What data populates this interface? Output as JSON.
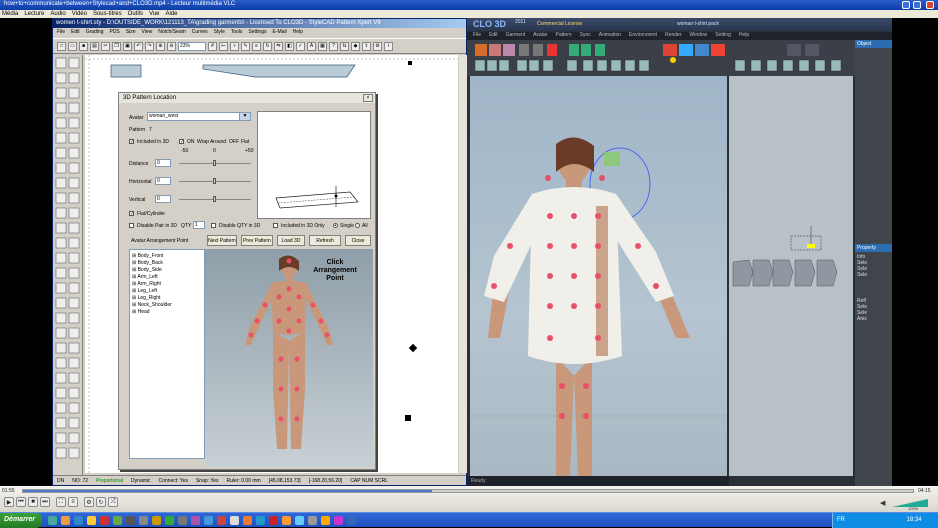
{
  "vlc": {
    "title": "how+to+communicate+between+Stylecad+and+CLO3D.mp4 - Lecteur multimédia VLC",
    "menu": [
      "Média",
      "Lecture",
      "Audio",
      "Vidéo",
      "Sous-titres",
      "Outils",
      "Vue",
      "Aide"
    ],
    "time_elapsed": "01:55",
    "time_total": "04:15",
    "progress": 0.46,
    "volume": "100%"
  },
  "stylecad": {
    "title": "women t-shirt.sty - D:\\OUTSIDE_WORK\\121113_TA\\grading garments\\ - Licensed To CLO3D - StyleCAD Pattern Xpert V9",
    "menu": [
      "File",
      "Edit",
      "Grading",
      "PDS",
      "Size",
      "View",
      "Notch/Seam",
      "Curves",
      "Style",
      "Tools",
      "Settings",
      "E-Mail",
      "Help"
    ],
    "zoom": "23%",
    "status": [
      "DN",
      "NO: 72",
      "Proportional",
      "Dynamic",
      "Connect: Yes",
      "Snap: Yes",
      "Ruler: 0.00 mm",
      "[45.08,153.73]",
      "[-168.20,56.20]",
      "CAP NUM SCRL"
    ]
  },
  "dialog": {
    "title": "3D Pattern Location",
    "avatar_label": "Avatar",
    "avatar_value": "woman_west",
    "pattern_label": "Pattern",
    "pattern_value": "7",
    "included_label": "Included in 3D",
    "wrap_label": "ON",
    "wrap_around": "Wrap Around",
    "off_label": "OFF",
    "flat_label": "Flat",
    "scale_min": "-50",
    "scale_mid": "0",
    "scale_max": "+50",
    "distance_label": "Distance",
    "distance_value": "0",
    "horizontal_label": "Horizontal",
    "horizontal_value": "0",
    "vertical_label": "Vertical",
    "vertical_value": "0",
    "flat_option": "Flat/Cylinder",
    "disable_pair": "Disable Pair in 3D",
    "qty_label": "QTY",
    "qty_value": "1",
    "disable_qty": "Disable QTY in 3D",
    "included_only": "Included in 3D Only",
    "single_label": "Single",
    "all_label": "All",
    "arrangement_title": "Avatar Arrangement Point",
    "next_pattern": "Next Pattern",
    "prev_pattern": "Prev Pattern",
    "load_3d": "Load 3D",
    "refresh": "Refresh",
    "close": "Close",
    "tree": [
      "Body_Front",
      "Body_Back",
      "Body_Side",
      "Arm_Left",
      "Arm_Right",
      "Leg_Left",
      "Leg_Right",
      "Neck_Shoulder",
      "Head"
    ],
    "overlay_line1": "Click",
    "overlay_line2": "Arrangement",
    "overlay_line3": "Point"
  },
  "clo": {
    "logo": "CLO 3D",
    "version": "2011",
    "license": "Commercial License",
    "filename": "woman t-shirt.pack",
    "menu": [
      "File",
      "Edit",
      "Garment",
      "Avatar",
      "Pattern",
      "Sync",
      "Animation",
      "Environment",
      "Render",
      "Window",
      "Setting",
      "Help"
    ],
    "status": "Ready",
    "right_panel_header": "Object",
    "right_items": [
      "Info",
      "Sele",
      "Sele",
      "Sele",
      "Refl",
      "Sele",
      "Sele",
      "Anis"
    ],
    "right_header2": "Property"
  },
  "taskbar": {
    "start": "Démarrer",
    "lang": "FR",
    "clock": "18:34"
  },
  "colors": {
    "accent_pink": "#e8506a",
    "clo_dark": "#2b2f36",
    "xp_blue": "#2c5cc8"
  }
}
